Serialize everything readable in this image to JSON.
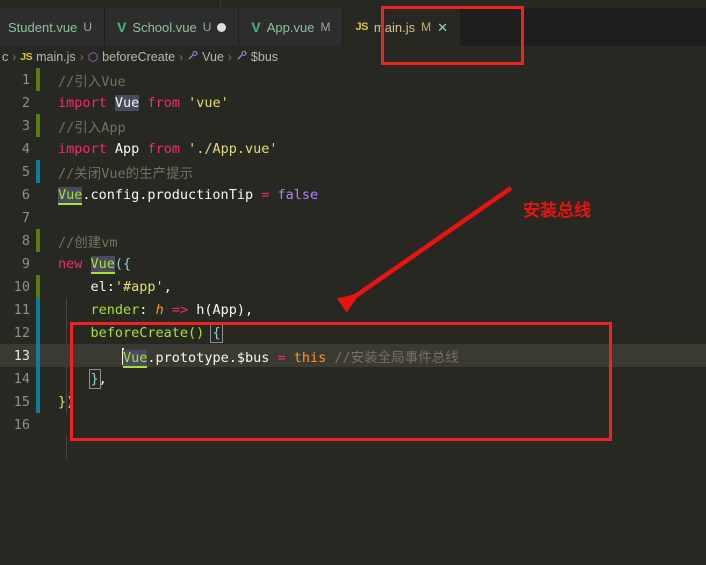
{
  "tabs": [
    {
      "icon": "vue-icon",
      "icon_glyph": "V",
      "label": "Student.vue",
      "badge": "U",
      "dot": "",
      "active": false,
      "clipped": true,
      "close": ""
    },
    {
      "icon": "vue-icon",
      "icon_glyph": "V",
      "label": "School.vue",
      "badge": "U",
      "dot": "●",
      "active": false,
      "clipped": false,
      "close": ""
    },
    {
      "icon": "vue-icon",
      "icon_glyph": "V",
      "label": "App.vue",
      "badge": "M",
      "dot": "",
      "active": false,
      "clipped": false,
      "close": ""
    },
    {
      "icon": "js-icon",
      "icon_glyph": "JS",
      "label": "main.js",
      "badge": "M",
      "dot": "",
      "active": true,
      "clipped": false,
      "close": "✕"
    }
  ],
  "breadcrumb": {
    "items": [
      {
        "icon": "",
        "icon_glyph": "",
        "label": "c"
      },
      {
        "icon": "js-icon",
        "icon_glyph": "JS",
        "label": "main.js"
      },
      {
        "icon": "method-icon",
        "icon_glyph": "⬡",
        "label": "beforeCreate"
      },
      {
        "icon": "field-icon",
        "icon_glyph": "🔧",
        "label": "Vue"
      },
      {
        "icon": "field-icon",
        "icon_glyph": "🔧",
        "label": "$bus"
      }
    ],
    "separator": "›"
  },
  "editor": {
    "lines": [
      {
        "n": "1",
        "change": "added",
        "current": false
      },
      {
        "n": "2",
        "change": "",
        "current": false
      },
      {
        "n": "3",
        "change": "added",
        "current": false
      },
      {
        "n": "4",
        "change": "",
        "current": false
      },
      {
        "n": "5",
        "change": "modified",
        "current": false
      },
      {
        "n": "6",
        "change": "",
        "current": false
      },
      {
        "n": "7",
        "change": "",
        "current": false
      },
      {
        "n": "8",
        "change": "added",
        "current": false
      },
      {
        "n": "9",
        "change": "",
        "current": false
      },
      {
        "n": "10",
        "change": "added",
        "current": false
      },
      {
        "n": "11",
        "change": "modified",
        "current": false
      },
      {
        "n": "12",
        "change": "modified",
        "current": false
      },
      {
        "n": "13",
        "change": "modified",
        "current": true
      },
      {
        "n": "14",
        "change": "modified",
        "current": false
      },
      {
        "n": "15",
        "change": "modified",
        "current": false
      },
      {
        "n": "16",
        "change": "",
        "current": false
      }
    ],
    "code": {
      "l1_comment": "//引入Vue",
      "l2_import": "import",
      "l2_vue": "Vue",
      "l2_from": "from",
      "l2_module": "'vue'",
      "l3_comment": "//引入App",
      "l4_import": "import",
      "l4_app": "App",
      "l4_from": "from",
      "l4_module": "'./App.vue'",
      "l5_comment": "//关闭Vue的生产提示",
      "l6_vue": "Vue",
      "l6_path": ".config.productionTip",
      "l6_eq": "=",
      "l6_val": "false",
      "l8_comment": "//创建vm",
      "l9_new": "new",
      "l9_vue": "Vue",
      "l9_open": "({",
      "l10_key": "el:",
      "l10_val": "'#app'",
      "l10_comma": ",",
      "l11_key": "render",
      "l11_colon": ":",
      "l11_h": " h ",
      "l11_arrow": "=>",
      "l11_call": " h(App),",
      "l12_fn": "beforeCreate()",
      "l12_brace": "{",
      "l13_vue": "Vue",
      "l13_path": ".prototype.$bus",
      "l13_eq": "=",
      "l13_this": "this",
      "l13_comment": "//安装全局事件总线",
      "l14_close": "}",
      "l14_comma": ",",
      "l15_close": "})"
    }
  },
  "annotations": {
    "label": "安装总线",
    "box_color": "#ee2222",
    "text_color": "#e81313"
  }
}
